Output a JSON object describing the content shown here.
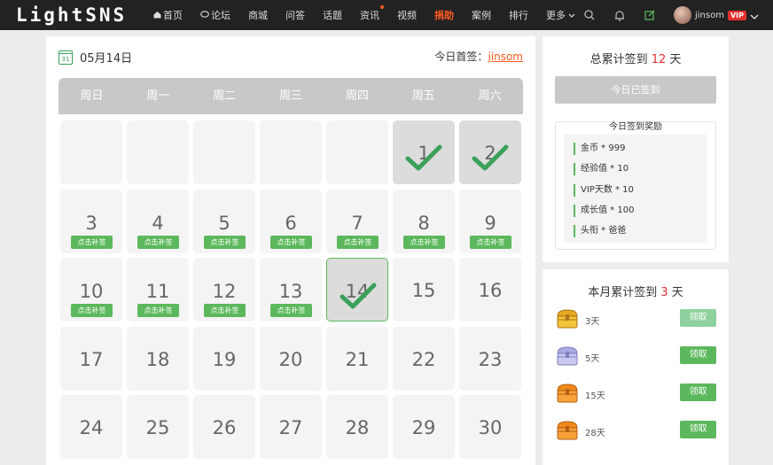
{
  "nav": {
    "logo": "LightSNS",
    "menu": [
      {
        "label": "首页",
        "icon": "home-icon",
        "active": false,
        "dot": false
      },
      {
        "label": "论坛",
        "icon": "chat-icon",
        "active": false,
        "dot": false
      },
      {
        "label": "商城",
        "active": false,
        "dot": false
      },
      {
        "label": "问答",
        "active": false,
        "dot": false
      },
      {
        "label": "话题",
        "active": false,
        "dot": false
      },
      {
        "label": "资讯",
        "active": false,
        "dot": true
      },
      {
        "label": "视频",
        "active": false,
        "dot": false
      },
      {
        "label": "捐助",
        "active": true,
        "dot": false
      },
      {
        "label": "案例",
        "active": false,
        "dot": false
      },
      {
        "label": "排行",
        "active": false,
        "dot": false
      },
      {
        "label": "更多",
        "active": false,
        "dot": false,
        "dropdown": true
      }
    ],
    "username": "jinsom",
    "vip": "VIP"
  },
  "calendar": {
    "date": "05月14日",
    "cal_icon_day": "31",
    "first_sign_label": "今日首签：",
    "first_sign_user": "jinsom",
    "weekdays": [
      "周日",
      "周一",
      "周二",
      "周三",
      "周四",
      "周五",
      "周六"
    ],
    "leading_blanks": 5,
    "makeup_label": "点击补签",
    "days": [
      {
        "d": "1",
        "state": "signed"
      },
      {
        "d": "2",
        "state": "signed"
      },
      {
        "d": "3",
        "state": "makeup"
      },
      {
        "d": "4",
        "state": "makeup"
      },
      {
        "d": "5",
        "state": "makeup"
      },
      {
        "d": "6",
        "state": "makeup"
      },
      {
        "d": "7",
        "state": "makeup"
      },
      {
        "d": "8",
        "state": "makeup"
      },
      {
        "d": "9",
        "state": "makeup"
      },
      {
        "d": "10",
        "state": "makeup"
      },
      {
        "d": "11",
        "state": "makeup"
      },
      {
        "d": "12",
        "state": "makeup"
      },
      {
        "d": "13",
        "state": "makeup"
      },
      {
        "d": "14",
        "state": "today"
      },
      {
        "d": "15",
        "state": "future"
      },
      {
        "d": "16",
        "state": "future"
      },
      {
        "d": "17",
        "state": "future"
      },
      {
        "d": "18",
        "state": "future"
      },
      {
        "d": "19",
        "state": "future"
      },
      {
        "d": "20",
        "state": "future"
      },
      {
        "d": "21",
        "state": "future"
      },
      {
        "d": "22",
        "state": "future"
      },
      {
        "d": "23",
        "state": "future"
      },
      {
        "d": "24",
        "state": "future"
      },
      {
        "d": "25",
        "state": "future"
      },
      {
        "d": "26",
        "state": "future"
      },
      {
        "d": "27",
        "state": "future"
      },
      {
        "d": "28",
        "state": "future"
      },
      {
        "d": "29",
        "state": "future"
      },
      {
        "d": "30",
        "state": "future"
      }
    ]
  },
  "total": {
    "prefix": "总累计签到 ",
    "count": "12",
    "suffix": " 天",
    "signed_button": "今日已签到",
    "reward_title": "今日签到奖励",
    "rewards": [
      "金币 * 999",
      "经验值 * 10",
      "VIP天数 * 10",
      "成长值 * 100",
      "头衔 * 爸爸"
    ]
  },
  "month": {
    "prefix": "本月累计签到 ",
    "count": "3",
    "suffix": " 天",
    "rows": [
      {
        "days": "3天",
        "button": "领取",
        "chest": "gold",
        "done": true
      },
      {
        "days": "5天",
        "button": "领取",
        "chest": "silver",
        "done": false
      },
      {
        "days": "15天",
        "button": "领取",
        "chest": "orange",
        "done": false
      },
      {
        "days": "28天",
        "button": "领取",
        "chest": "orange",
        "done": false
      }
    ]
  },
  "colors": {
    "accent": "#ff5a1f",
    "green": "#5cb85c",
    "red": "#e63030"
  }
}
